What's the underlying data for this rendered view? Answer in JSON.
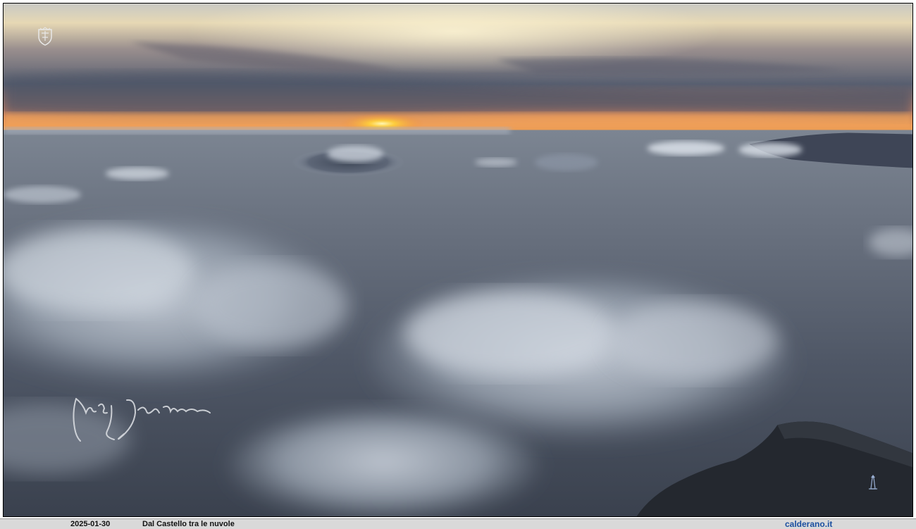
{
  "caption": {
    "date": "2025-01-30",
    "title": "Dal Castello tra le nuvole",
    "site": "calderano.it"
  },
  "watermarks": {
    "crest": "crest-icon",
    "signature": "handwritten-signature",
    "lighthouse": "lighthouse-icon"
  },
  "colors": {
    "sky_glow": "#f7d28a",
    "sun": "#ffd23a",
    "sea": "#4d5663",
    "clouds": "#b9c2cd",
    "caption_bg": "#d9d9d9",
    "site_link": "#1a4fa0"
  }
}
